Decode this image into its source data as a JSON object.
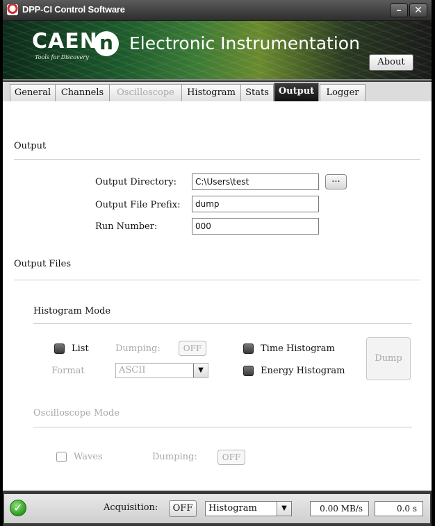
{
  "window": {
    "title": "DPP-CI Control Software"
  },
  "banner": {
    "logo": "CAEN",
    "tagline": "Tools for Discovery",
    "logo_mark": "n",
    "title": "Electronic Instrumentation",
    "about_label": "About"
  },
  "tabs": [
    {
      "label": "General",
      "state": "normal"
    },
    {
      "label": "Channels",
      "state": "normal"
    },
    {
      "label": "Oscilloscope",
      "state": "disabled"
    },
    {
      "label": "Histogram",
      "state": "normal"
    },
    {
      "label": "Stats",
      "state": "normal"
    },
    {
      "label": "Output",
      "state": "active"
    },
    {
      "label": "Logger",
      "state": "normal"
    }
  ],
  "output": {
    "section_title": "Output",
    "dir_label": "Output Directory:",
    "dir_value": "C:\\Users\\test",
    "browse_label": "...",
    "prefix_label": "Output File Prefix:",
    "prefix_value": "dump",
    "run_label": "Run Number:",
    "run_value": "000"
  },
  "output_files": {
    "section_title": "Output Files",
    "histogram_mode": {
      "title": "Histogram Mode",
      "list_label": "List",
      "dumping_label": "Dumping:",
      "dumping_value": "OFF",
      "format_label": "Format",
      "format_value": "ASCII",
      "time_hist_label": "Time Histogram",
      "energy_hist_label": "Energy Histogram",
      "dump_label": "Dump"
    },
    "oscilloscope_mode": {
      "title": "Oscilloscope Mode",
      "waves_label": "Waves",
      "dumping_label": "Dumping:",
      "dumping_value": "OFF"
    }
  },
  "statusbar": {
    "acquisition_label": "Acquisition:",
    "acquisition_value": "OFF",
    "mode_value": "Histogram",
    "rate": "0.00 MB/s",
    "time": "0.0 s"
  }
}
